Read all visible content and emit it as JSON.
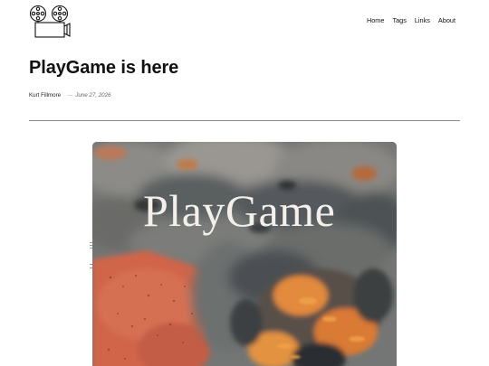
{
  "nav": {
    "items": [
      {
        "label": "Home"
      },
      {
        "label": "Tags"
      },
      {
        "label": "Links"
      },
      {
        "label": "About"
      }
    ]
  },
  "logo": {
    "icon": "film-projector-icon"
  },
  "post": {
    "title": "PlayGame is here",
    "author": "Kurt Fillmore",
    "separator": "—",
    "date": "June 27, 2026"
  },
  "hero": {
    "text": "PlayGame",
    "colors": {
      "smoke": "#6f7270",
      "ember": "#d86a4c",
      "flame": "#e58a3a",
      "text": "#f3efea"
    }
  }
}
